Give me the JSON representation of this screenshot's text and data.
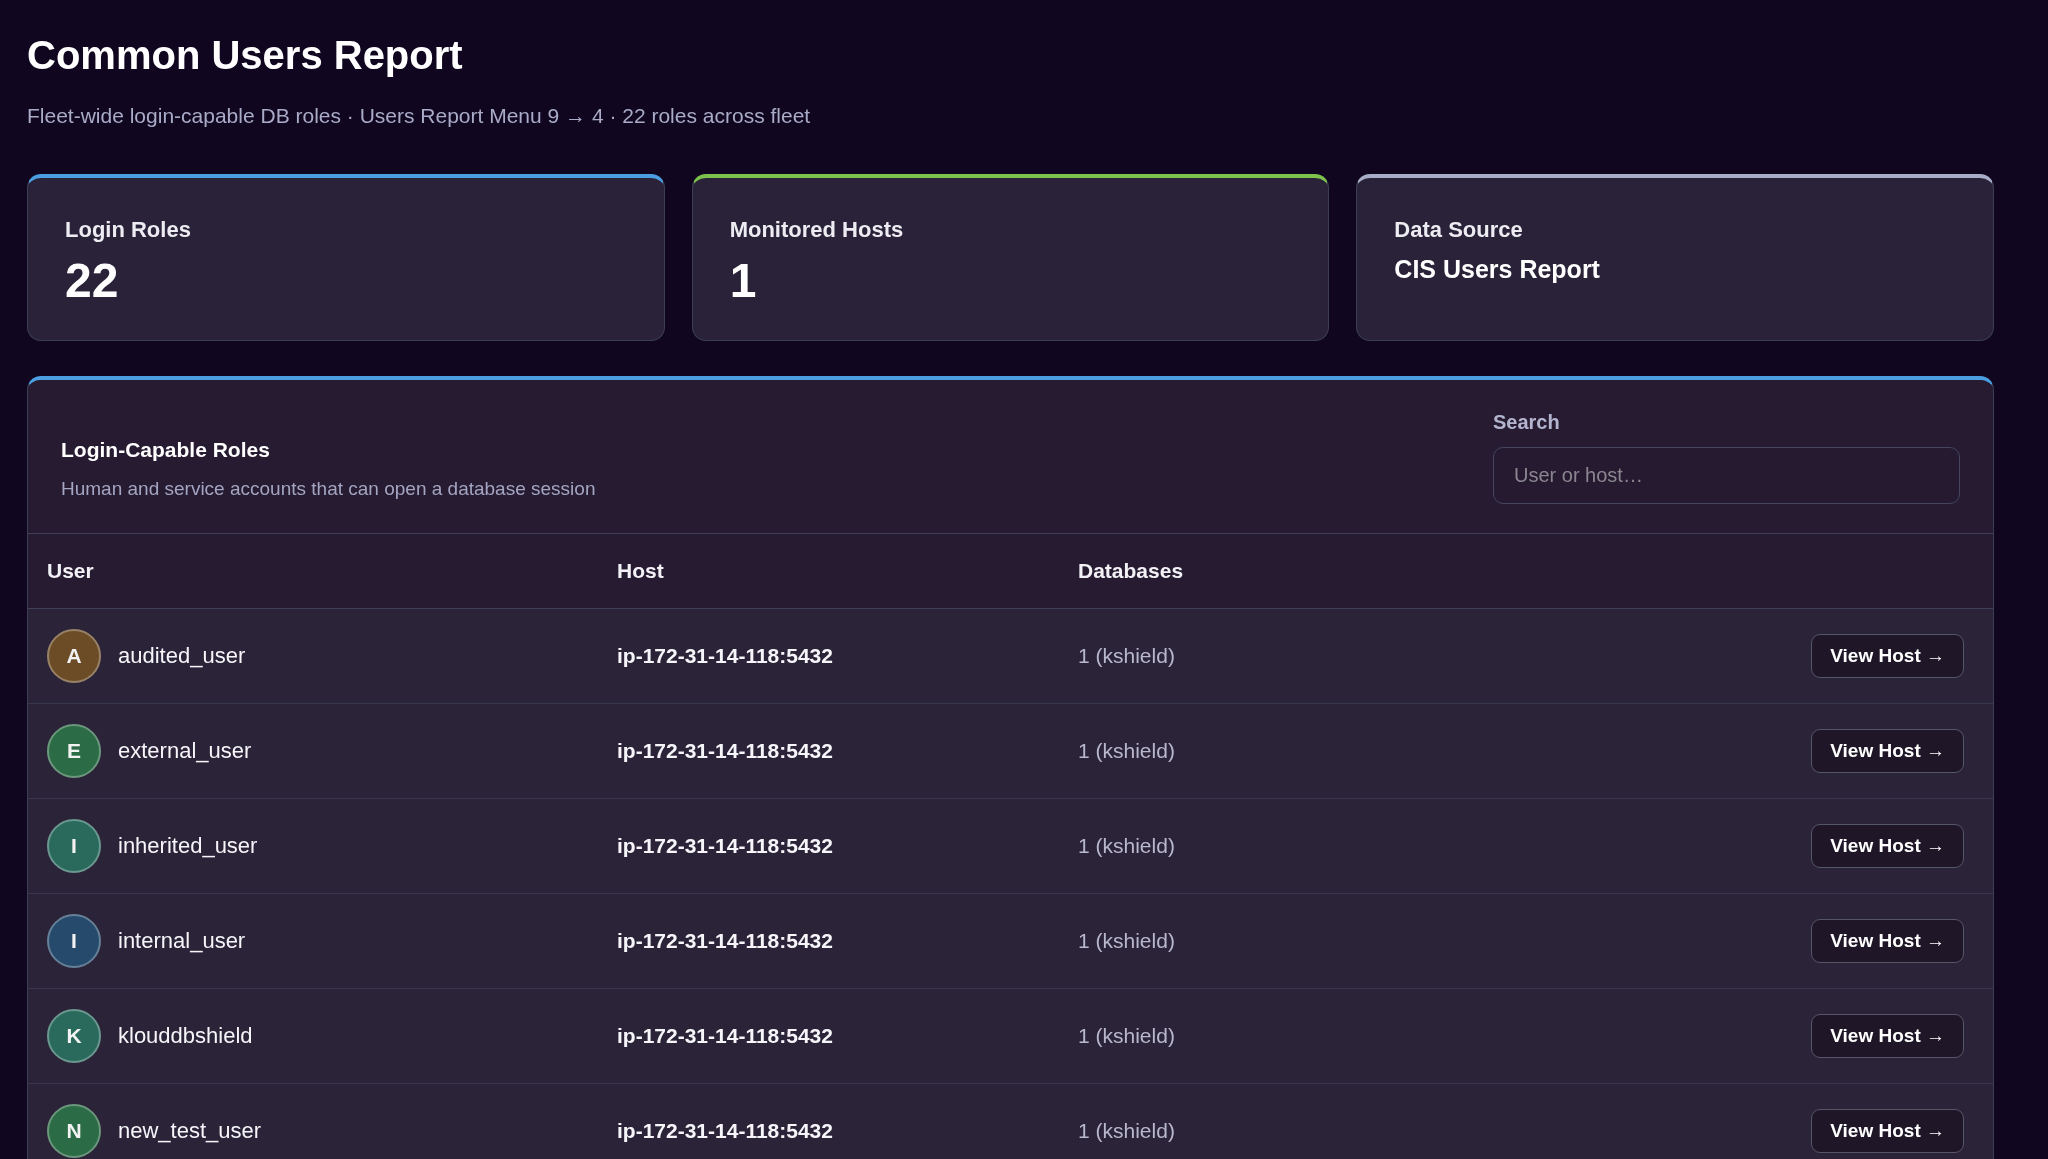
{
  "page": {
    "title": "Common Users Report",
    "subtitle": "Fleet-wide login-capable DB roles · Users Report Menu 9 → 4 · 22 roles across fleet"
  },
  "stats": [
    {
      "label": "Login Roles",
      "value": "22",
      "kind": "number",
      "color": "#4b9fe1"
    },
    {
      "label": "Monitored Hosts",
      "value": "1",
      "kind": "number",
      "color": "#7cc24c"
    },
    {
      "label": "Data Source",
      "value": "CIS Users Report",
      "kind": "text",
      "color": "#a9aec8"
    }
  ],
  "panel": {
    "title": "Login-Capable Roles",
    "description": "Human and service accounts that can open a database session",
    "search": {
      "label": "Search",
      "placeholder": "User or host…"
    },
    "table": {
      "columns": [
        "User",
        "Host",
        "Databases"
      ],
      "rows": [
        {
          "initial": "A",
          "user": "audited_user",
          "host": "ip-172-31-14-118:5432",
          "databases": "1 (kshield)",
          "action": "View Host →",
          "color": "#6b4c26"
        },
        {
          "initial": "E",
          "user": "external_user",
          "host": "ip-172-31-14-118:5432",
          "databases": "1 (kshield)",
          "action": "View Host →",
          "color": "#2b6b45"
        },
        {
          "initial": "I",
          "user": "inherited_user",
          "host": "ip-172-31-14-118:5432",
          "databases": "1 (kshield)",
          "action": "View Host →",
          "color": "#2a6a5d"
        },
        {
          "initial": "I",
          "user": "internal_user",
          "host": "ip-172-31-14-118:5432",
          "databases": "1 (kshield)",
          "action": "View Host →",
          "color": "#254a6c"
        },
        {
          "initial": "K",
          "user": "klouddbshield",
          "host": "ip-172-31-14-118:5432",
          "databases": "1 (kshield)",
          "action": "View Host →",
          "color": "#2a6a5d"
        },
        {
          "initial": "N",
          "user": "new_test_user",
          "host": "ip-172-31-14-118:5432",
          "databases": "1 (kshield)",
          "action": "View Host →",
          "color": "#2b6b45"
        }
      ]
    }
  }
}
